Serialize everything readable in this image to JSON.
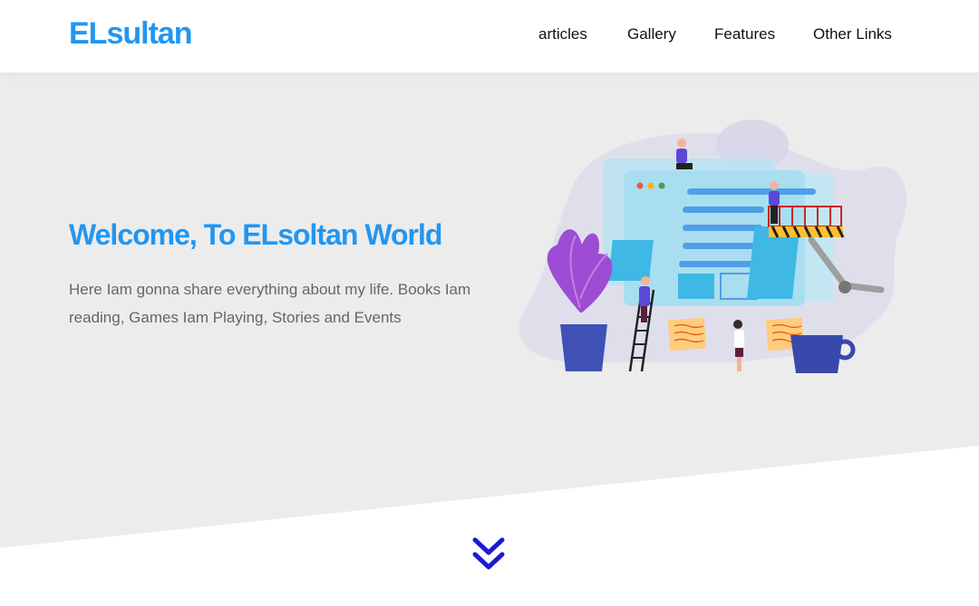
{
  "header": {
    "logo": "ELsultan",
    "nav": [
      "articles",
      "Gallery",
      "Features",
      "Other Links"
    ]
  },
  "landing": {
    "title": "Welcome, To ELsoltan World",
    "description": "Here Iam gonna share everything about my life. Books Iam reading, Games Iam Playing, Stories and Events"
  },
  "icons": {
    "scroll": "double-chevron-down-icon"
  },
  "colors": {
    "brand": "#2196f3",
    "landing_bg": "#ececec",
    "chevron": "#1a1ad6"
  }
}
